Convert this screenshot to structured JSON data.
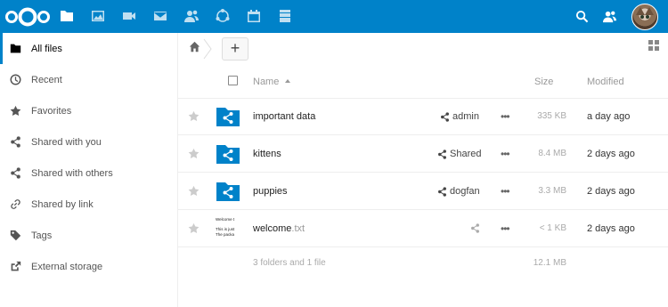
{
  "header": {
    "apps": [
      {
        "name": "files-icon",
        "active": true
      },
      {
        "name": "gallery-icon",
        "active": false
      },
      {
        "name": "video-icon",
        "active": false
      },
      {
        "name": "mail-icon",
        "active": false
      },
      {
        "name": "contacts-icon",
        "active": false
      },
      {
        "name": "circles-icon",
        "active": false
      },
      {
        "name": "calendar-icon",
        "active": false
      },
      {
        "name": "deck-icon",
        "active": false
      }
    ],
    "colors": {
      "brand": "#0082c9"
    }
  },
  "sidebar": {
    "items": [
      {
        "label": "All files",
        "icon": "folder-icon"
      },
      {
        "label": "Recent",
        "icon": "clock-icon"
      },
      {
        "label": "Favorites",
        "icon": "star-icon"
      },
      {
        "label": "Shared with you",
        "icon": "share-icon"
      },
      {
        "label": "Shared with others",
        "icon": "share-icon"
      },
      {
        "label": "Shared by link",
        "icon": "link-icon"
      },
      {
        "label": "Tags",
        "icon": "tag-icon"
      },
      {
        "label": "External storage",
        "icon": "external-icon"
      }
    ]
  },
  "controls": {
    "new_label": "+"
  },
  "table": {
    "headers": {
      "name": "Name",
      "size": "Size",
      "modified": "Modified"
    },
    "rows": [
      {
        "name": "important data",
        "ext": "",
        "type": "shared-folder",
        "share": "admin",
        "size": "335 KB",
        "modified": "a day ago"
      },
      {
        "name": "kittens",
        "ext": "",
        "type": "shared-folder",
        "share": "Shared",
        "size": "8.4 MB",
        "modified": "2 days ago"
      },
      {
        "name": "puppies",
        "ext": "",
        "type": "shared-folder",
        "share": "dogfan",
        "size": "3.3 MB",
        "modified": "2 days ago"
      },
      {
        "name": "welcome",
        "ext": ".txt",
        "type": "text-file",
        "share": "",
        "size": "< 1 KB",
        "modified": "2 days ago",
        "thumbnail": [
          "Welcome t",
          "",
          "This is just",
          "The packa"
        ]
      }
    ],
    "summary": {
      "text": "3 folders and 1 file",
      "size": "12.1 MB"
    }
  }
}
